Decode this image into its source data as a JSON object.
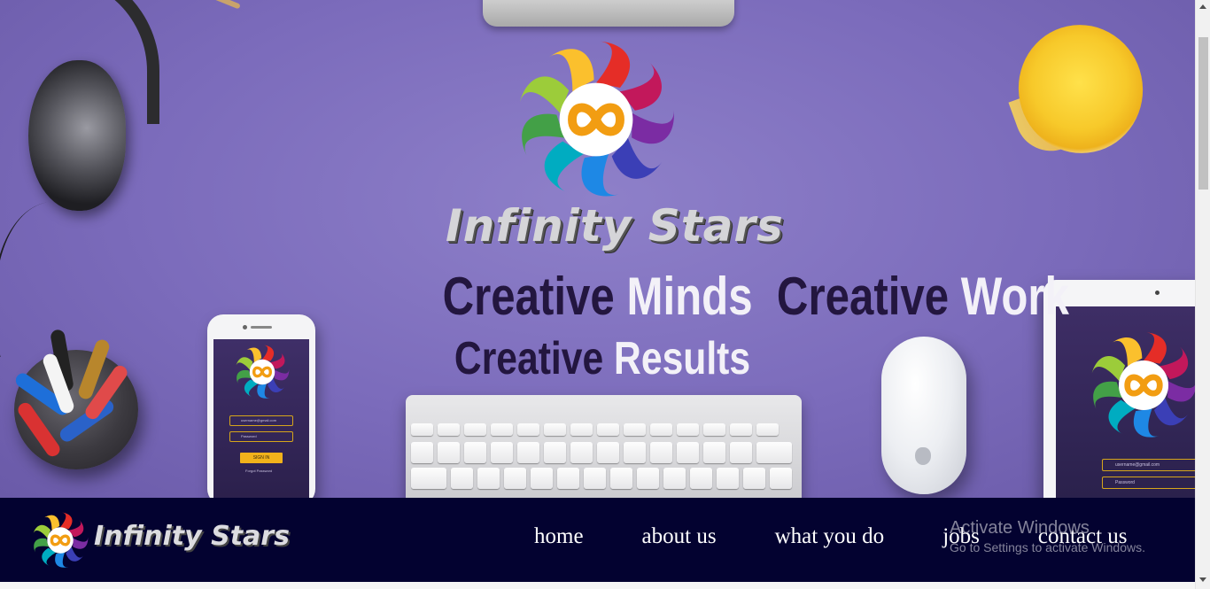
{
  "hero": {
    "brand_name": "Infinity Stars",
    "slogan_line1": {
      "w1": "Creative",
      "w2": "Minds",
      "w3": "Creative",
      "w4": "Work"
    },
    "slogan_line2": {
      "w1": "Creative",
      "w2": "Results"
    },
    "phone_mockup": {
      "email_placeholder": "username@gmail.com",
      "password_placeholder": "Password",
      "signin_label": "SIGN IN",
      "forgot_label": "Forgot Password"
    },
    "tablet_mockup": {
      "email_placeholder": "username@gmail.com",
      "password_placeholder": "Password"
    }
  },
  "navbar": {
    "brand_name": "Infinity Stars",
    "links": [
      "home",
      "about us",
      "what you do",
      "jobs",
      "contact us"
    ]
  },
  "watermark": {
    "line1": "Activate Windows",
    "line2": "Go to Settings to activate Windows."
  },
  "colors": {
    "hero_bg": "#7b6bbb",
    "navbar_bg": "#030230",
    "slogan_dark": "#23163f",
    "slogan_light": "#f3f1f8",
    "accent_gold": "#f1b21b"
  },
  "icons": {
    "logo": "infinity-swirl-logo-icon",
    "apple": "apple-logo-icon"
  }
}
